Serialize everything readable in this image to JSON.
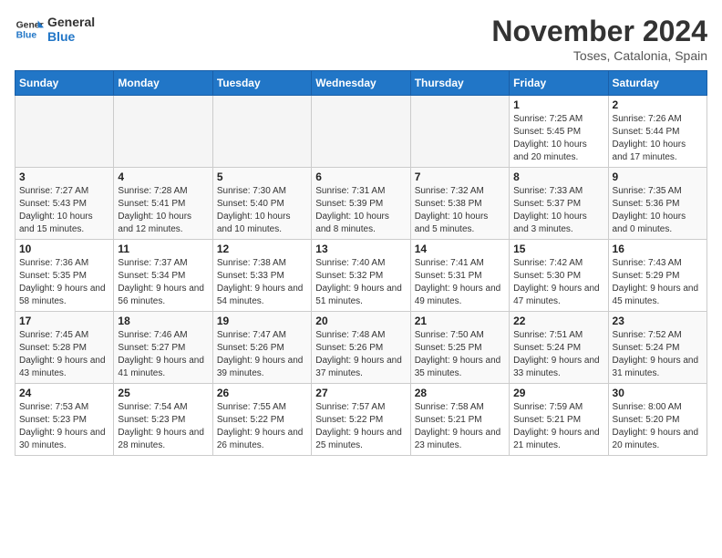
{
  "header": {
    "logo_line1": "General",
    "logo_line2": "Blue",
    "month": "November 2024",
    "location": "Toses, Catalonia, Spain"
  },
  "weekdays": [
    "Sunday",
    "Monday",
    "Tuesday",
    "Wednesday",
    "Thursday",
    "Friday",
    "Saturday"
  ],
  "weeks": [
    [
      {
        "day": "",
        "info": ""
      },
      {
        "day": "",
        "info": ""
      },
      {
        "day": "",
        "info": ""
      },
      {
        "day": "",
        "info": ""
      },
      {
        "day": "",
        "info": ""
      },
      {
        "day": "1",
        "info": "Sunrise: 7:25 AM\nSunset: 5:45 PM\nDaylight: 10 hours and 20 minutes."
      },
      {
        "day": "2",
        "info": "Sunrise: 7:26 AM\nSunset: 5:44 PM\nDaylight: 10 hours and 17 minutes."
      }
    ],
    [
      {
        "day": "3",
        "info": "Sunrise: 7:27 AM\nSunset: 5:43 PM\nDaylight: 10 hours and 15 minutes."
      },
      {
        "day": "4",
        "info": "Sunrise: 7:28 AM\nSunset: 5:41 PM\nDaylight: 10 hours and 12 minutes."
      },
      {
        "day": "5",
        "info": "Sunrise: 7:30 AM\nSunset: 5:40 PM\nDaylight: 10 hours and 10 minutes."
      },
      {
        "day": "6",
        "info": "Sunrise: 7:31 AM\nSunset: 5:39 PM\nDaylight: 10 hours and 8 minutes."
      },
      {
        "day": "7",
        "info": "Sunrise: 7:32 AM\nSunset: 5:38 PM\nDaylight: 10 hours and 5 minutes."
      },
      {
        "day": "8",
        "info": "Sunrise: 7:33 AM\nSunset: 5:37 PM\nDaylight: 10 hours and 3 minutes."
      },
      {
        "day": "9",
        "info": "Sunrise: 7:35 AM\nSunset: 5:36 PM\nDaylight: 10 hours and 0 minutes."
      }
    ],
    [
      {
        "day": "10",
        "info": "Sunrise: 7:36 AM\nSunset: 5:35 PM\nDaylight: 9 hours and 58 minutes."
      },
      {
        "day": "11",
        "info": "Sunrise: 7:37 AM\nSunset: 5:34 PM\nDaylight: 9 hours and 56 minutes."
      },
      {
        "day": "12",
        "info": "Sunrise: 7:38 AM\nSunset: 5:33 PM\nDaylight: 9 hours and 54 minutes."
      },
      {
        "day": "13",
        "info": "Sunrise: 7:40 AM\nSunset: 5:32 PM\nDaylight: 9 hours and 51 minutes."
      },
      {
        "day": "14",
        "info": "Sunrise: 7:41 AM\nSunset: 5:31 PM\nDaylight: 9 hours and 49 minutes."
      },
      {
        "day": "15",
        "info": "Sunrise: 7:42 AM\nSunset: 5:30 PM\nDaylight: 9 hours and 47 minutes."
      },
      {
        "day": "16",
        "info": "Sunrise: 7:43 AM\nSunset: 5:29 PM\nDaylight: 9 hours and 45 minutes."
      }
    ],
    [
      {
        "day": "17",
        "info": "Sunrise: 7:45 AM\nSunset: 5:28 PM\nDaylight: 9 hours and 43 minutes."
      },
      {
        "day": "18",
        "info": "Sunrise: 7:46 AM\nSunset: 5:27 PM\nDaylight: 9 hours and 41 minutes."
      },
      {
        "day": "19",
        "info": "Sunrise: 7:47 AM\nSunset: 5:26 PM\nDaylight: 9 hours and 39 minutes."
      },
      {
        "day": "20",
        "info": "Sunrise: 7:48 AM\nSunset: 5:26 PM\nDaylight: 9 hours and 37 minutes."
      },
      {
        "day": "21",
        "info": "Sunrise: 7:50 AM\nSunset: 5:25 PM\nDaylight: 9 hours and 35 minutes."
      },
      {
        "day": "22",
        "info": "Sunrise: 7:51 AM\nSunset: 5:24 PM\nDaylight: 9 hours and 33 minutes."
      },
      {
        "day": "23",
        "info": "Sunrise: 7:52 AM\nSunset: 5:24 PM\nDaylight: 9 hours and 31 minutes."
      }
    ],
    [
      {
        "day": "24",
        "info": "Sunrise: 7:53 AM\nSunset: 5:23 PM\nDaylight: 9 hours and 30 minutes."
      },
      {
        "day": "25",
        "info": "Sunrise: 7:54 AM\nSunset: 5:23 PM\nDaylight: 9 hours and 28 minutes."
      },
      {
        "day": "26",
        "info": "Sunrise: 7:55 AM\nSunset: 5:22 PM\nDaylight: 9 hours and 26 minutes."
      },
      {
        "day": "27",
        "info": "Sunrise: 7:57 AM\nSunset: 5:22 PM\nDaylight: 9 hours and 25 minutes."
      },
      {
        "day": "28",
        "info": "Sunrise: 7:58 AM\nSunset: 5:21 PM\nDaylight: 9 hours and 23 minutes."
      },
      {
        "day": "29",
        "info": "Sunrise: 7:59 AM\nSunset: 5:21 PM\nDaylight: 9 hours and 21 minutes."
      },
      {
        "day": "30",
        "info": "Sunrise: 8:00 AM\nSunset: 5:20 PM\nDaylight: 9 hours and 20 minutes."
      }
    ]
  ]
}
